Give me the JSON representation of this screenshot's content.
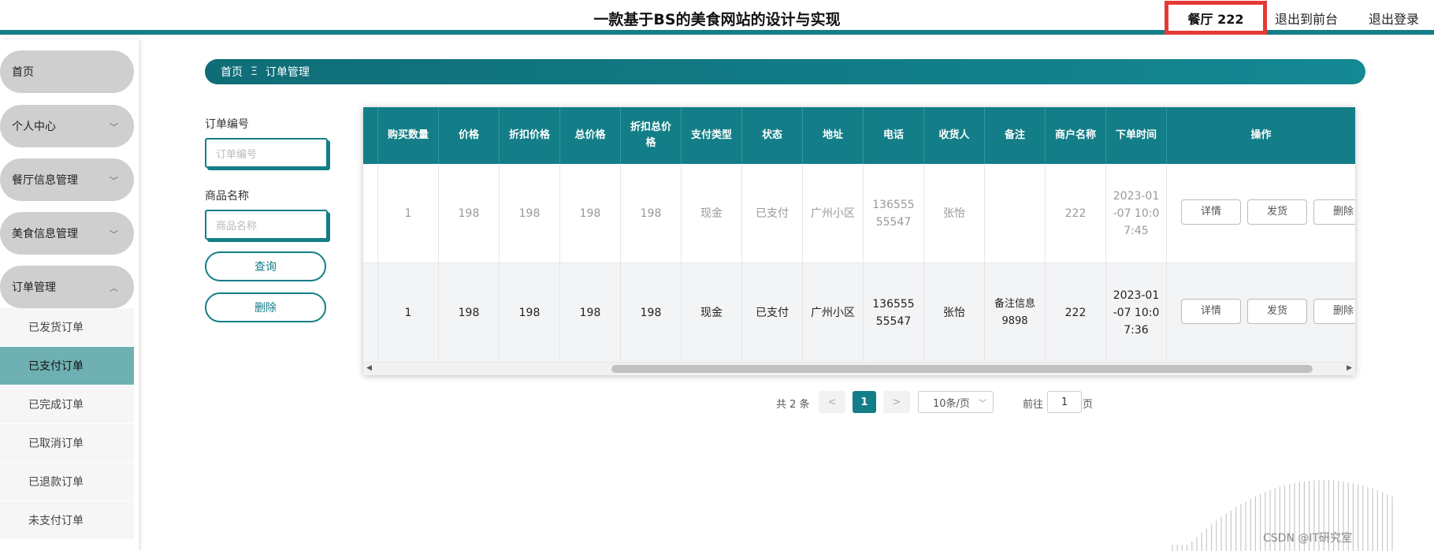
{
  "header": {
    "title": "一款基于BS的美食网站的设计与实现",
    "user_label": "餐厅 222",
    "to_front_label": "退出到前台",
    "logout_label": "退出登录"
  },
  "sidebar": {
    "items": [
      {
        "label": "首页"
      },
      {
        "label": "个人中心",
        "chevron": "chevron-down-icon"
      },
      {
        "label": "餐厅信息管理",
        "chevron": "chevron-down-icon"
      },
      {
        "label": "美食信息管理",
        "chevron": "chevron-down-icon"
      },
      {
        "label": "订单管理",
        "chevron": "chevron-up-icon"
      }
    ],
    "submenu": [
      {
        "label": "已发货订单"
      },
      {
        "label": "已支付订单",
        "active": true
      },
      {
        "label": "已完成订单"
      },
      {
        "label": "已取消订单"
      },
      {
        "label": "已退款订单"
      },
      {
        "label": "未支付订单"
      }
    ]
  },
  "breadcrumb": {
    "home": "首页",
    "separator": "Ξ",
    "current": "订单管理"
  },
  "search": {
    "order_no_label": "订单编号",
    "order_no_placeholder": "订单编号",
    "product_name_label": "商品名称",
    "product_name_placeholder": "商品名称",
    "query_button": "查询",
    "delete_button": "删除"
  },
  "table": {
    "columns": [
      {
        "label": "购买数量"
      },
      {
        "label": "价格"
      },
      {
        "label": "折扣价格"
      },
      {
        "label": "总价格"
      },
      {
        "label": "折扣总价格"
      },
      {
        "label": "支付类型"
      },
      {
        "label": "状态"
      },
      {
        "label": "地址"
      },
      {
        "label": "电话"
      },
      {
        "label": "收货人"
      },
      {
        "label": "备注"
      },
      {
        "label": "商户名称"
      },
      {
        "label": "下单时间"
      },
      {
        "label": "操作"
      }
    ],
    "rows": [
      {
        "quantity": "1",
        "price": "198",
        "discount_price": "198",
        "total_price": "198",
        "discount_total": "198",
        "payment_type": "现金",
        "status": "已支付",
        "address": "广州小区",
        "phone": "13655555547",
        "receiver": "张怡",
        "remark": "",
        "merchant": "222",
        "order_time": "2023-01-07 10:07:45"
      },
      {
        "quantity": "1",
        "price": "198",
        "discount_price": "198",
        "total_price": "198",
        "discount_total": "198",
        "payment_type": "现金",
        "status": "已支付",
        "address": "广州小区",
        "phone": "13655555547",
        "receiver": "张怡",
        "remark": "备注信息9898",
        "merchant": "222",
        "order_time": "2023-01-07 10:07:36"
      }
    ],
    "actions": {
      "detail": "详情",
      "ship": "发货",
      "delete": "删除"
    }
  },
  "pagination": {
    "total": "共 2 条",
    "prev": "<",
    "current_page": "1",
    "next": ">",
    "page_size": "10条/页",
    "goto_label": "前往",
    "goto_value": "1",
    "page_unit": "页"
  },
  "watermark": "CSDN @IT研究室",
  "colors": {
    "primary": "#137e87",
    "highlight": "#e53935",
    "active_menu": "#6fb0b2"
  }
}
